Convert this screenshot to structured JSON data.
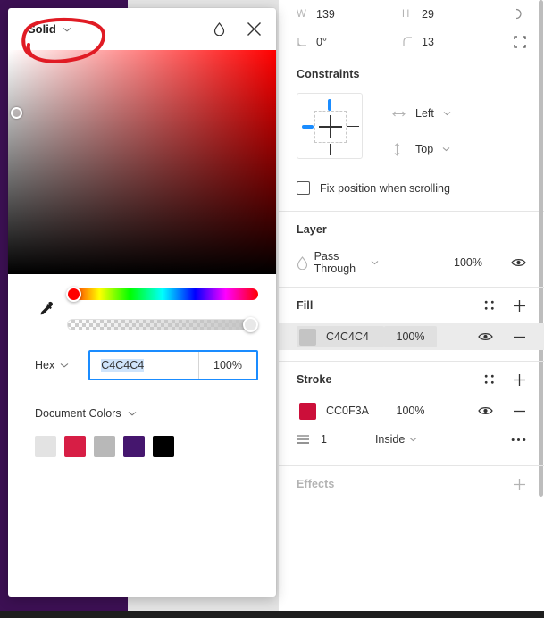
{
  "inspector": {
    "dimensions": {
      "width_label": "W",
      "width_value": "139",
      "height_label": "H",
      "height_value": "29",
      "rotation_value": "0°",
      "corner_radius_value": "13",
      "proportion_icon": "proportion-lock-icon",
      "independent_corners_icon": "independent-corners-icon"
    },
    "constraints": {
      "title": "Constraints",
      "horizontal_value": "Left",
      "vertical_value": "Top",
      "fix_position_label": "Fix position when scrolling",
      "fix_position_checked": false,
      "active_color": "#1a8cff"
    },
    "layer": {
      "title": "Layer",
      "blend_mode": "Pass Through",
      "opacity": "100%",
      "blend_icon": "blend-mode-icon",
      "visibility_icon": "eye-icon"
    },
    "fill": {
      "title": "Fill",
      "style_icon": "style-grid-icon",
      "add_icon": "plus-icon",
      "items": [
        {
          "hex": "C4C4C4",
          "color": "#c4c4c4",
          "opacity": "100%",
          "visibility_icon": "eye-icon",
          "remove_icon": "minus-icon",
          "selected": true
        }
      ]
    },
    "stroke": {
      "title": "Stroke",
      "style_icon": "style-grid-icon",
      "add_icon": "plus-icon",
      "items": [
        {
          "hex": "CC0F3A",
          "color": "#cc0f3a",
          "opacity": "100%",
          "visibility_icon": "eye-icon",
          "remove_icon": "minus-icon"
        }
      ],
      "weight": "1",
      "alignment": "Inside",
      "weight_icon": "stroke-weight-icon",
      "more_icon": "ellipsis-icon"
    },
    "effects": {
      "title": "Effects",
      "add_icon": "plus-icon"
    },
    "help_button": {
      "label": "?",
      "name": "help-button"
    }
  },
  "color_picker": {
    "type_label": "Solid",
    "type_chevron_icon": "chevron-down-icon",
    "blend_icon": "blend-mode-icon",
    "close_icon": "close-icon",
    "eyedropper_icon": "eyedropper-icon",
    "current_color": "#ff0000",
    "sv_handle": {
      "saturation": 3,
      "value": 72
    },
    "hue_position_pct": 0,
    "alpha_position_pct": 100,
    "hex": {
      "mode_label": "Hex",
      "mode_chevron_icon": "chevron-down-icon",
      "value": "C4C4C4",
      "opacity": "100%",
      "focused": true,
      "text_selected": true
    },
    "document_colors": {
      "title": "Document Colors",
      "chevron_icon": "chevron-down-icon",
      "swatches": [
        "#e3e3e3",
        "#d71e45",
        "#b8b8b8",
        "#45166e",
        "#000000"
      ]
    }
  },
  "annotation": {
    "shape": "ellipse",
    "color": "#e01b24",
    "target": "Solid"
  }
}
